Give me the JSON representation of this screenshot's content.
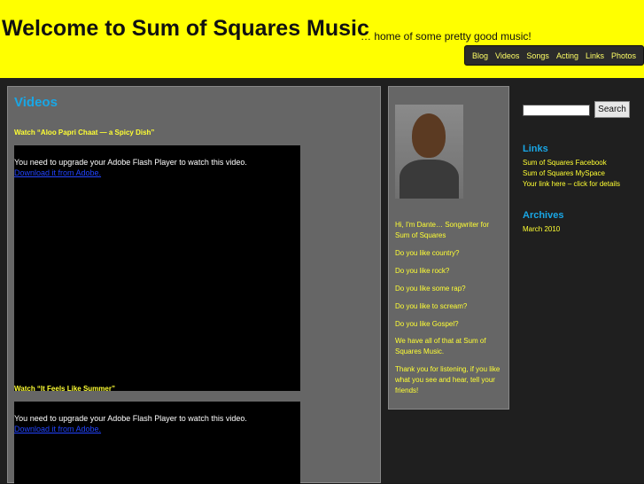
{
  "header": {
    "title": "Welcome to Sum of Squares Music",
    "tagline": "… home of some pretty good music!",
    "nav": [
      "Blog",
      "Videos",
      "Songs",
      "Acting",
      "Links",
      "Photos"
    ]
  },
  "main": {
    "heading": "Videos",
    "videos": [
      {
        "title": "Watch “Aloo Papri Chaat — a Spicy Dish”",
        "message": "You need to upgrade your Adobe Flash Player to watch this video.",
        "link": "Download it from Adobe."
      },
      {
        "title": "Watch “It Feels Like Summer”",
        "message": "You need to upgrade your Adobe Flash Player to watch this video.",
        "link": "Download it from Adobe."
      }
    ]
  },
  "about": {
    "paragraphs": [
      "Hi, I'm Dante… Songwriter for Sum of Squares",
      "Do you like country?",
      "Do you like rock?",
      "Do you like some rap?",
      "Do you like to scream?",
      "Do you like Gospel?",
      "We have all of that at Sum of Squares Music.",
      "Thank you for listening, if you like what you see and hear, tell your friends!"
    ]
  },
  "sidebar": {
    "search_button": "Search",
    "links_heading": "Links",
    "links": [
      "Sum of Squares Facebook",
      "Sum of Squares MySpace",
      "Your link here – click for details"
    ],
    "archives_heading": "Archives",
    "archives": [
      "March 2010"
    ]
  }
}
